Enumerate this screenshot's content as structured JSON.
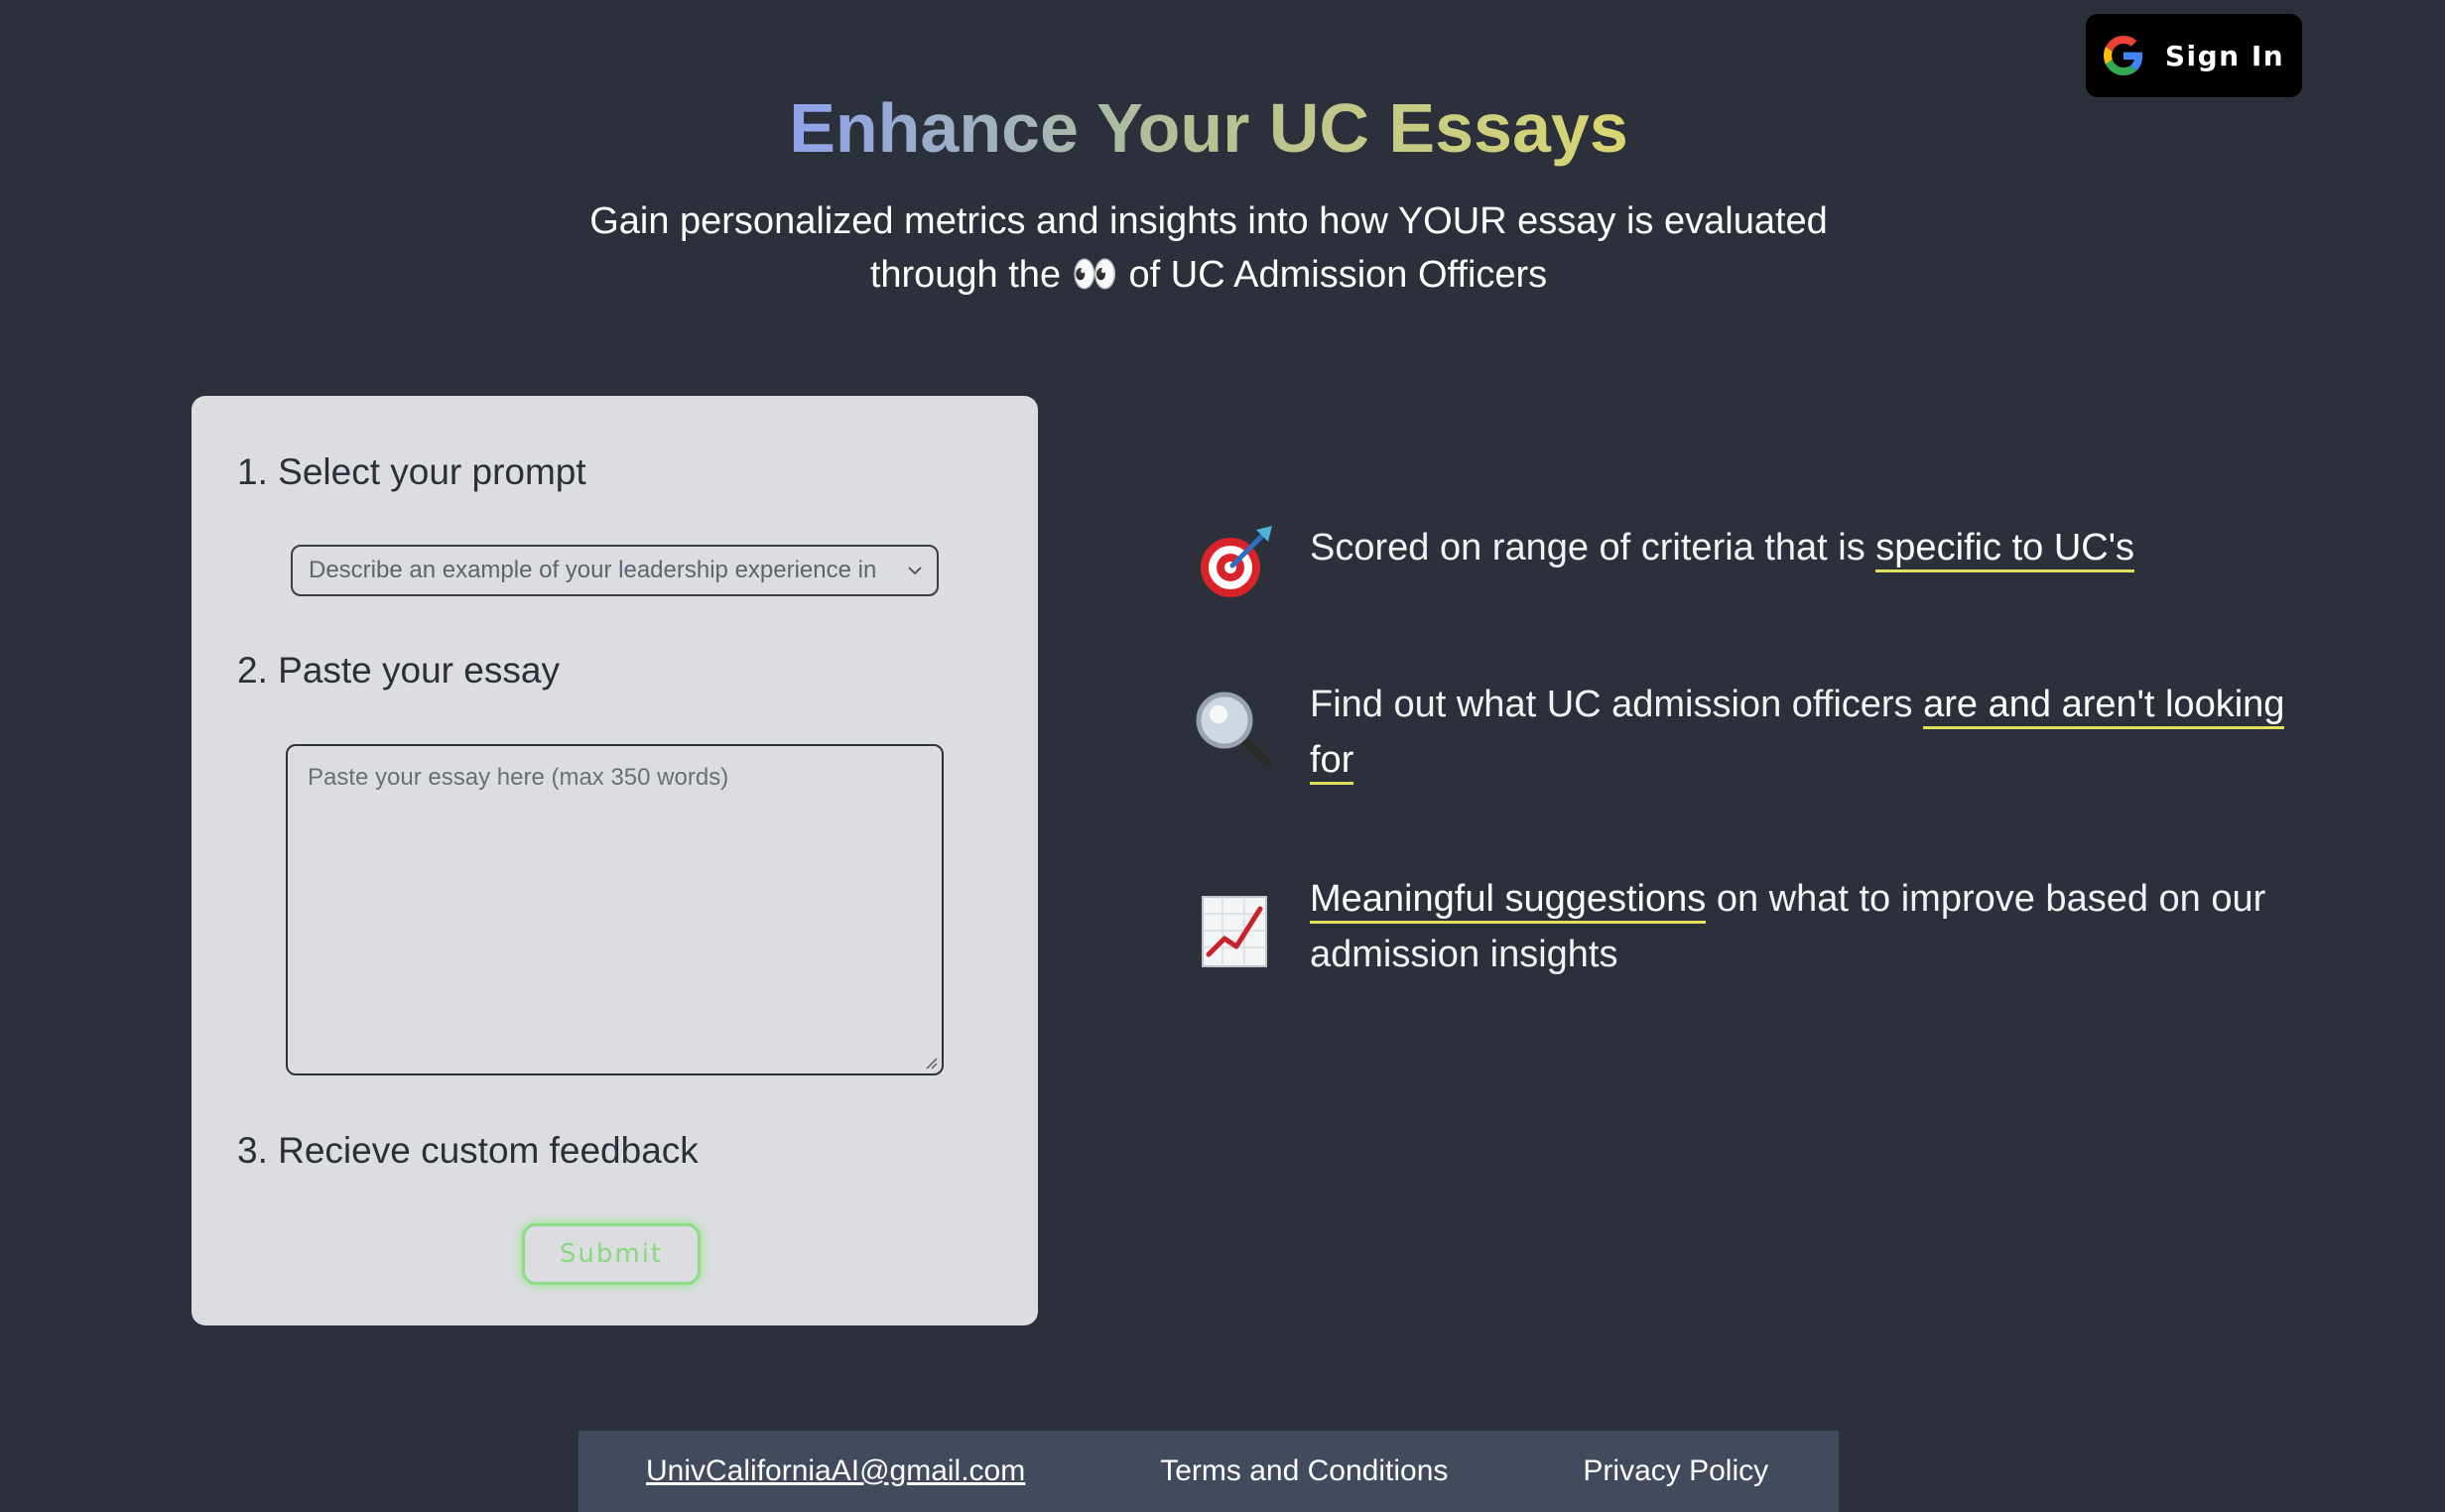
{
  "header": {
    "signin_label": "Sign In",
    "signin_icon": "google-g-icon"
  },
  "hero": {
    "title": "Enhance Your UC Essays",
    "subtitle_line1": "Gain personalized metrics and insights into how YOUR essay is evaluated",
    "subtitle_line2_pre": "through the ",
    "subtitle_eyes": "👀",
    "subtitle_line2_post": " of UC Admission Officers"
  },
  "form": {
    "step1_label": "1. Select your prompt",
    "prompt_selected": "Describe an example of your leadership experience in",
    "step2_label": "2. Paste your essay",
    "essay_placeholder": "Paste your essay here (max 350 words)",
    "step3_label": "3. Recieve custom feedback",
    "submit_label": "Submit"
  },
  "features": [
    {
      "icon": "target-dart-icon",
      "text_pre": "Scored on range of criteria that is ",
      "highlight": "specific to UC's",
      "text_post": ""
    },
    {
      "icon": "magnifying-glass-icon",
      "text_pre": "Find out what UC admission officers ",
      "highlight": "are and aren't looking for",
      "text_post": ""
    },
    {
      "icon": "chart-increasing-icon",
      "text_pre": "",
      "highlight": "Meaningful suggestions",
      "text_post": " on what to improve based on our admission insights"
    }
  ],
  "footer": {
    "email": "UnivCaliforniaAI@gmail.com",
    "terms": "Terms and Conditions",
    "privacy": "Privacy Policy"
  },
  "colors": {
    "background": "#2c303b",
    "card": "#dcdde1",
    "footer": "#434a5d",
    "highlight_underline": "#e3e05c",
    "submit_green": "#87d87e"
  }
}
